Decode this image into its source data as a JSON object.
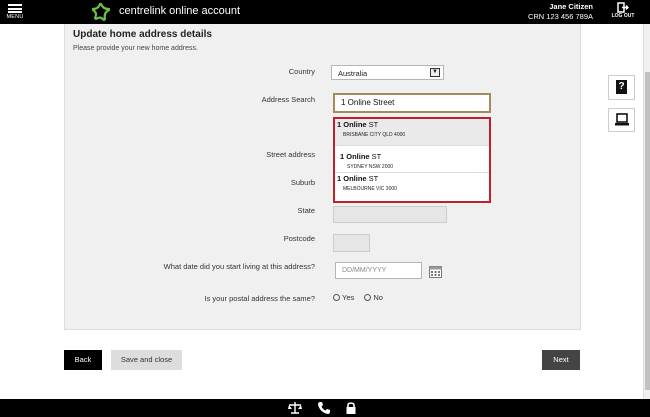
{
  "header": {
    "menu_label": "MENU",
    "app_title": "centrelink online account",
    "user_name": "Jane Citizen",
    "crn": "CRN 123 456 789A",
    "logout_label": "LOG OUT"
  },
  "form": {
    "title": "Update home address details",
    "subtitle": "Please provide your new home address.",
    "country_label": "Country",
    "country_value": "Australia",
    "search_label": "Address Search",
    "search_value": "1 Online Street",
    "street_label": "Street address",
    "suburb_label": "Suburb",
    "state_label": "State",
    "postcode_label": "Postcode",
    "date_label": "What date did you start living at this address?",
    "date_placeholder": "DD/MM/YYYY",
    "postal_label": "Is your postal address the same?",
    "yes_label": "Yes",
    "no_label": "No"
  },
  "suggestions": [
    {
      "match": "1 Online",
      "rest": " ST",
      "locality": "BRISBANE CITY QLD 4000"
    },
    {
      "match": "1 Online",
      "rest": " ST",
      "locality": "SYDNEY NSW 2000"
    },
    {
      "match": "1 Online",
      "rest": " ST",
      "locality": "MELBOURNE VIC 3000"
    }
  ],
  "buttons": {
    "back": "Back",
    "save_close": "Save and close",
    "next": "Next"
  },
  "side": {
    "help_symbol": "?"
  },
  "colors": {
    "highlight_border": "#c0202a",
    "search_border": "#a38a5d",
    "logo_green": "#6cc04a"
  },
  "icons": [
    "menu-icon",
    "centrelink-logo",
    "logout-icon",
    "help-icon",
    "chat-icon",
    "calendar-icon",
    "scales-icon",
    "phone-icon",
    "lock-icon"
  ]
}
